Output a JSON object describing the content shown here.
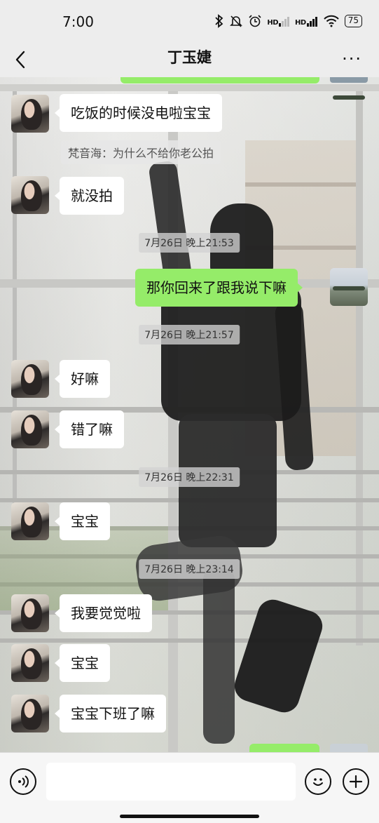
{
  "status_bar": {
    "time": "7:00",
    "icons": [
      "bluetooth-icon",
      "mute-icon",
      "alarm-icon",
      "signal-hd-1-icon",
      "signal-hd-2-icon",
      "wifi-icon",
      "battery-icon"
    ],
    "hd_label_1": "HD",
    "hd_label_2": "HD",
    "battery_level": "75"
  },
  "header": {
    "title": "丁玉婕",
    "back_icon": "chevron-left-icon",
    "more_icon": "more-dots-icon",
    "more_glyph": "···"
  },
  "messages": [
    {
      "type": "text",
      "side": "left",
      "text": "吃饭的时候没电啦宝宝"
    },
    {
      "type": "quote",
      "text": "梵音海：为什么不给你老公拍"
    },
    {
      "type": "text",
      "side": "left",
      "text": "就没拍"
    },
    {
      "type": "time",
      "text": "7月26日 晚上21:53"
    },
    {
      "type": "text",
      "side": "right",
      "text": "那你回来了跟我说下嘛"
    },
    {
      "type": "time",
      "text": "7月26日 晚上21:57"
    },
    {
      "type": "text",
      "side": "left",
      "text": "好嘛"
    },
    {
      "type": "text",
      "side": "left",
      "text": "错了嘛"
    },
    {
      "type": "time",
      "text": "7月26日 晚上22:31"
    },
    {
      "type": "text",
      "side": "left",
      "text": "宝宝"
    },
    {
      "type": "time",
      "text": "7月26日 晚上23:14"
    },
    {
      "type": "text",
      "side": "left",
      "text": "我要觉觉啦"
    },
    {
      "type": "text",
      "side": "left",
      "text": "宝宝"
    },
    {
      "type": "text",
      "side": "left",
      "text": "宝宝下班了嘛"
    }
  ],
  "input_bar": {
    "voice_icon": "voice-icon",
    "emoji_icon": "emoji-icon",
    "plus_icon": "plus-icon",
    "placeholder": "",
    "value": ""
  },
  "colors": {
    "bubble_self": "#95ec69",
    "bubble_other": "#ffffff",
    "background": "#ededed"
  }
}
